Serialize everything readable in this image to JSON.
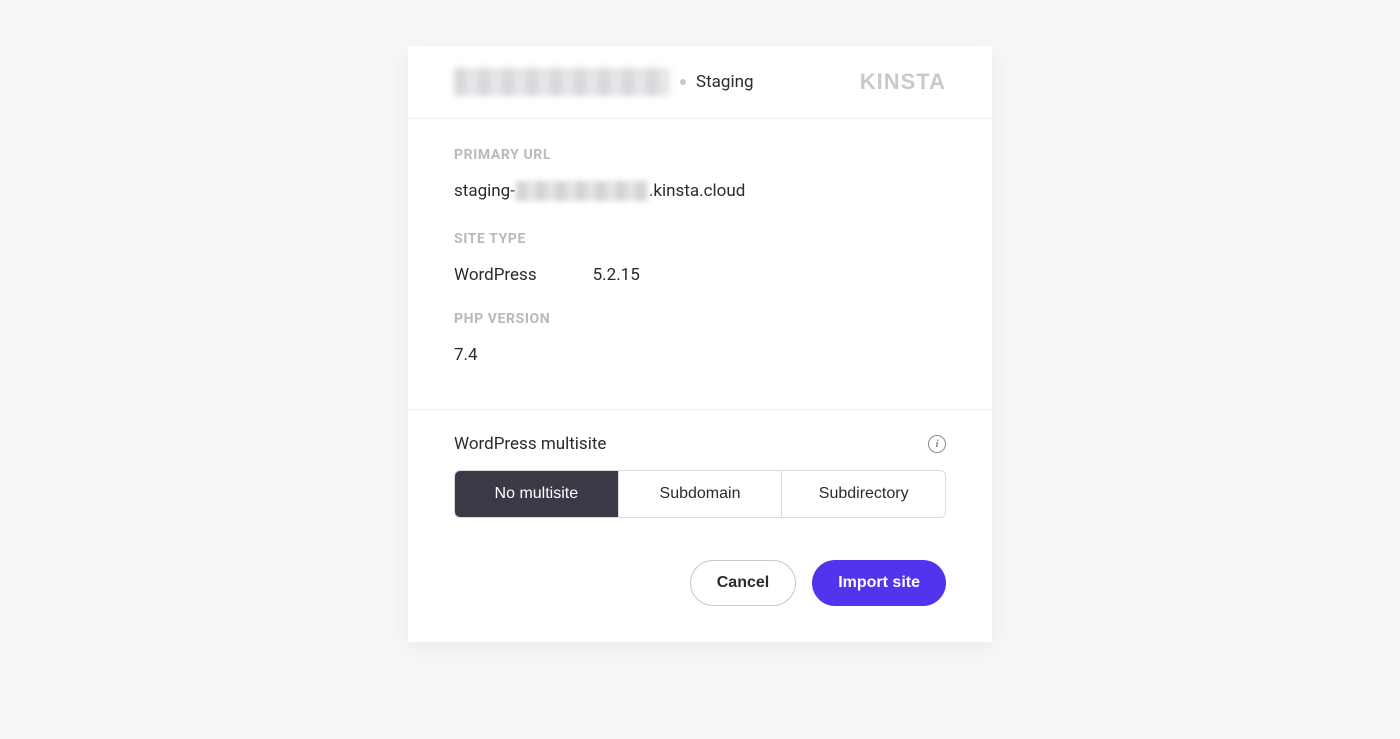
{
  "header": {
    "site_name_redacted": true,
    "environment": "Staging",
    "brand": "KINSTA"
  },
  "info": {
    "primary_url_label": "PRIMARY URL",
    "primary_url_prefix": "staging-",
    "primary_url_mid_redacted": true,
    "primary_url_suffix": ".kinsta.cloud",
    "site_type_label": "SITE TYPE",
    "site_type_name": "WordPress",
    "site_type_version": "5.2.15",
    "php_version_label": "PHP VERSION",
    "php_version_value": "7.4"
  },
  "multisite": {
    "title": "WordPress multisite",
    "options": {
      "none": "No multisite",
      "subdomain": "Subdomain",
      "subdirectory": "Subdirectory"
    },
    "selected": "none"
  },
  "actions": {
    "cancel": "Cancel",
    "import": "Import site"
  }
}
